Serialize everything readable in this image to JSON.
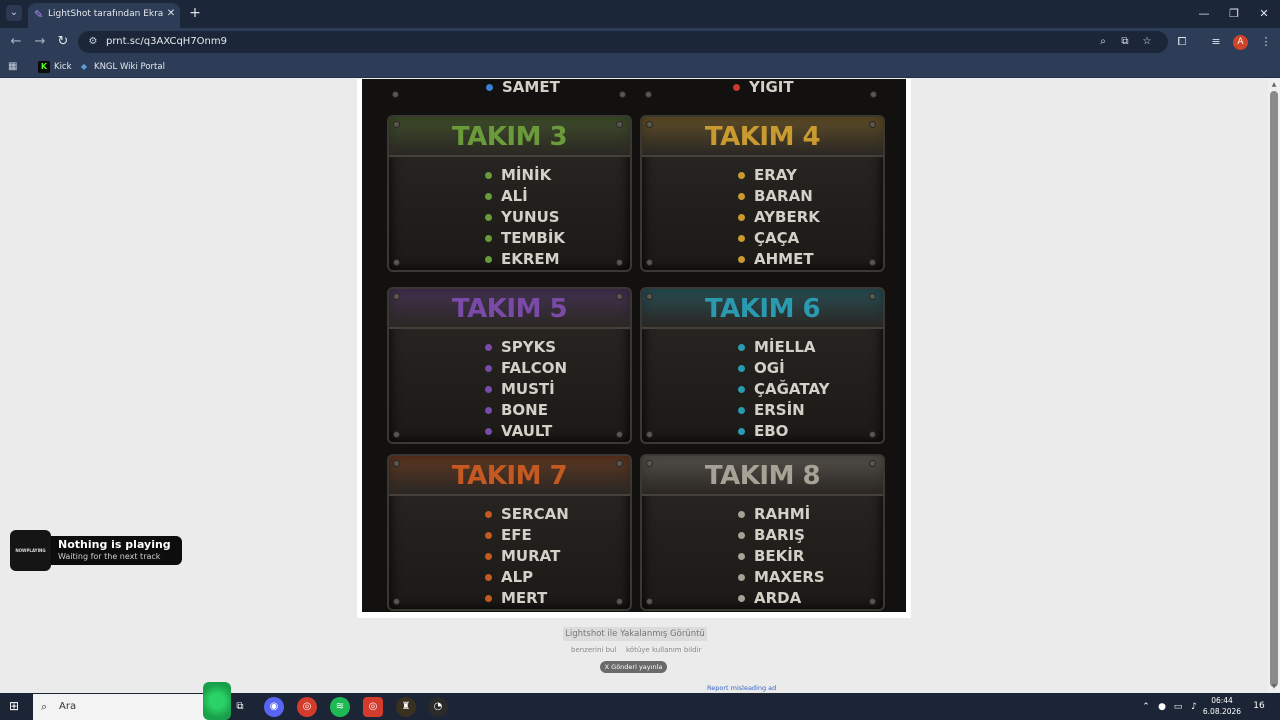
{
  "browser": {
    "tab_title": "LightShot tarafından Ekran Görü",
    "tab_close": "✕",
    "new_tab": "+",
    "url": "prnt.sc/q3AXCqH7Onm9",
    "controls": {
      "minimize": "—",
      "restore": "❐",
      "close": "✕"
    }
  },
  "bookmarks": [
    {
      "label": "Kick",
      "icon": "kick-icon",
      "color": "#53fc18"
    },
    {
      "label": "KNGL Wiki Portal",
      "icon": "wiki-icon",
      "color": "#5aa0d8"
    }
  ],
  "profile": {
    "initial": "A"
  },
  "image": {
    "top_row": [
      {
        "name": "SAMET",
        "color": "#3a7fd4"
      },
      {
        "name": "YIGIT",
        "color": "#c73a2a"
      }
    ],
    "teams": [
      {
        "title": "TAKIM 3",
        "color": "#6a9a3a",
        "players": [
          "MİNİK",
          "ALİ",
          "YUNUS",
          "TEMBİK",
          "EKREM"
        ]
      },
      {
        "title": "TAKIM 4",
        "color": "#c99a30",
        "players": [
          "ERAY",
          "BARAN",
          "AYBERK",
          "ÇAÇA",
          "AHMET"
        ]
      },
      {
        "title": "TAKIM 5",
        "color": "#7a4aa8",
        "players": [
          "SPYKS",
          "FALCON",
          "MUSTİ",
          "BONE",
          "VAULT"
        ]
      },
      {
        "title": "TAKIM 6",
        "color": "#2a9ab0",
        "players": [
          "MİELLA",
          "OGİ",
          "ÇAĞATAY",
          "ERSİN",
          "EBO"
        ]
      },
      {
        "title": "TAKIM 7",
        "color": "#c45a22",
        "players": [
          "SERCAN",
          "EFE",
          "MURAT",
          "ALP",
          "MERT"
        ]
      },
      {
        "title": "TAKIM 8",
        "color": "#a8a296",
        "players": [
          "RAHMİ",
          "BARIŞ",
          "BEKİR",
          "MAXERS",
          "ARDA"
        ]
      }
    ]
  },
  "page": {
    "capture_label": "Lightshot ile Yakalanmış Görüntü",
    "similar_link": "benzerini bul",
    "report_abuse": "kötüye kullanım bildir",
    "share_button": "X  Gönderi yayınla",
    "report_ad": "Report misleading ad"
  },
  "now_playing": {
    "title": "Nothing is playing",
    "subtitle": "Waiting for the next track",
    "art_text": "NOWPLAYING"
  },
  "taskbar": {
    "search_placeholder": "Ara",
    "time": "06:44",
    "date": "6.08.2026",
    "notification_count": "16"
  }
}
